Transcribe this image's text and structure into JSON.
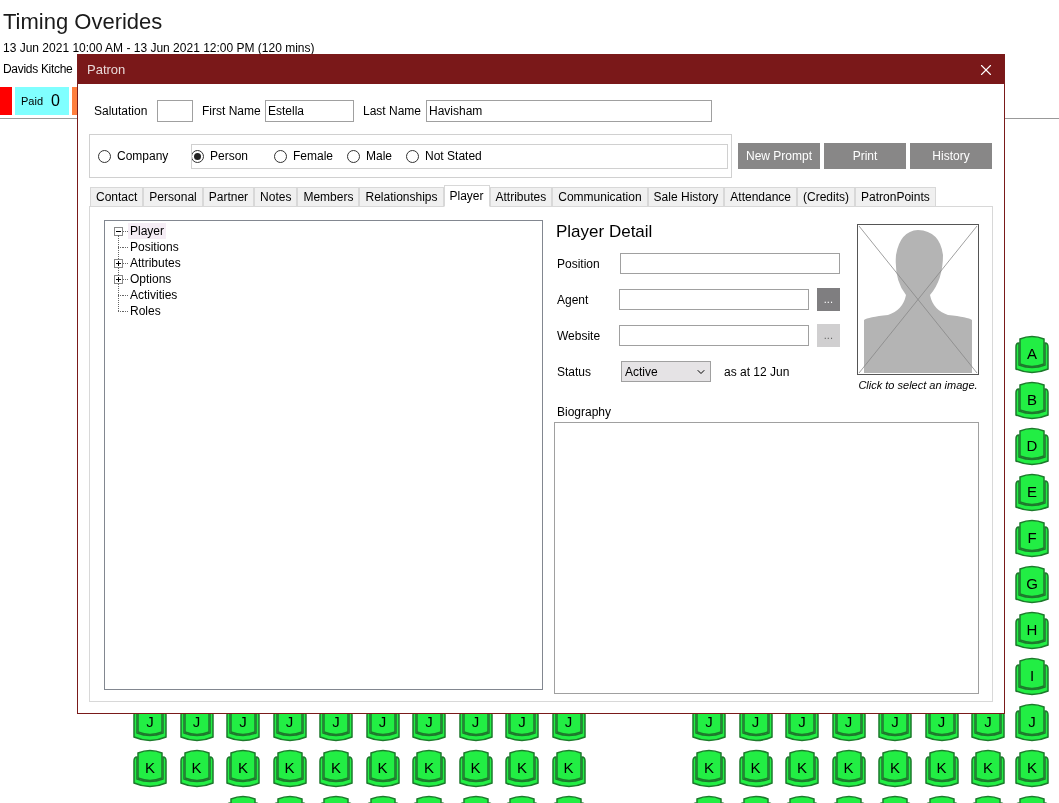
{
  "page": {
    "title": "Timing Overides",
    "date_range": "13 Jun 2021 10:00 AM - 13 Jun 2021 12:00 PM (120 mins)",
    "venue": "Davids Kitche"
  },
  "status_chips": [
    {
      "color": "#ff0000"
    },
    {
      "label": "Paid",
      "count": "0",
      "color": "#80ffff"
    },
    {
      "color": "#ff7f3f"
    }
  ],
  "seat_map": {
    "left_block": [
      [
        "J",
        "J",
        "J",
        "J",
        "J",
        "J",
        "J",
        "J",
        "J",
        "J"
      ],
      [
        "K",
        "K",
        "K",
        "K",
        "K",
        "K",
        "K",
        "K",
        "K",
        "K"
      ]
    ],
    "right_block": [
      [
        "J",
        "J",
        "J",
        "J",
        "J",
        "J",
        "J"
      ],
      [
        "K",
        "K",
        "K",
        "K",
        "K",
        "K",
        "K"
      ]
    ],
    "right_column": [
      "A",
      "B",
      "D",
      "E",
      "F",
      "G",
      "H",
      "I",
      "J",
      "K"
    ]
  },
  "dialog": {
    "title": "Patron",
    "fields": [
      {
        "label": "Salutation"
      },
      {
        "label": "First Name",
        "value": "Estella"
      },
      {
        "label": "Last Name",
        "value": "Havisham"
      }
    ],
    "patron_type": [
      {
        "label": "Company",
        "selected": false
      },
      {
        "label": "Person",
        "selected": true
      }
    ],
    "gender": [
      {
        "label": "Female",
        "selected": false
      },
      {
        "label": "Male",
        "selected": false
      },
      {
        "label": "Not Stated",
        "selected": false
      }
    ],
    "buttons": [
      "New Prompt",
      "Print",
      "History"
    ],
    "tabs": [
      {
        "label": "Contact",
        "selected": false
      },
      {
        "label": "Personal",
        "selected": false
      },
      {
        "label": "Partner",
        "selected": false
      },
      {
        "label": "Notes",
        "selected": false
      },
      {
        "label": "Members",
        "selected": false
      },
      {
        "label": "Relationships",
        "selected": false
      },
      {
        "label": "Player",
        "selected": true
      },
      {
        "label": "Attributes",
        "selected": false
      },
      {
        "label": "Communication",
        "selected": false
      },
      {
        "label": "Sale History",
        "selected": false
      },
      {
        "label": "Attendance",
        "selected": false
      },
      {
        "label": "(Credits)",
        "selected": false
      },
      {
        "label": "PatronPoints",
        "selected": false
      }
    ],
    "tree": [
      {
        "label": "Player",
        "kind": "folder",
        "expanded": true,
        "selected": true,
        "children": [
          {
            "label": "Positions",
            "kind": "leaf",
            "selected": false
          },
          {
            "label": "Attributes",
            "kind": "folder",
            "expanded": false,
            "selected": false
          },
          {
            "label": "Options",
            "kind": "folder",
            "expanded": false,
            "selected": false
          },
          {
            "label": "Activities",
            "kind": "leaf",
            "selected": false
          },
          {
            "label": "Roles",
            "kind": "leaf",
            "selected": false
          }
        ]
      }
    ],
    "detail": {
      "heading": "Player Detail",
      "rows": [
        {
          "kind": "text",
          "label": "Position"
        },
        {
          "kind": "lookup",
          "label": "Agent",
          "button": "...",
          "disabled": false
        },
        {
          "kind": "lookup",
          "label": "Website",
          "button": "...",
          "disabled": true
        },
        {
          "kind": "select",
          "label": "Status",
          "value": "Active",
          "note": "as at 12 Jun"
        }
      ],
      "image_caption": "Click to select an image.",
      "biography_label": "Biography"
    }
  }
}
